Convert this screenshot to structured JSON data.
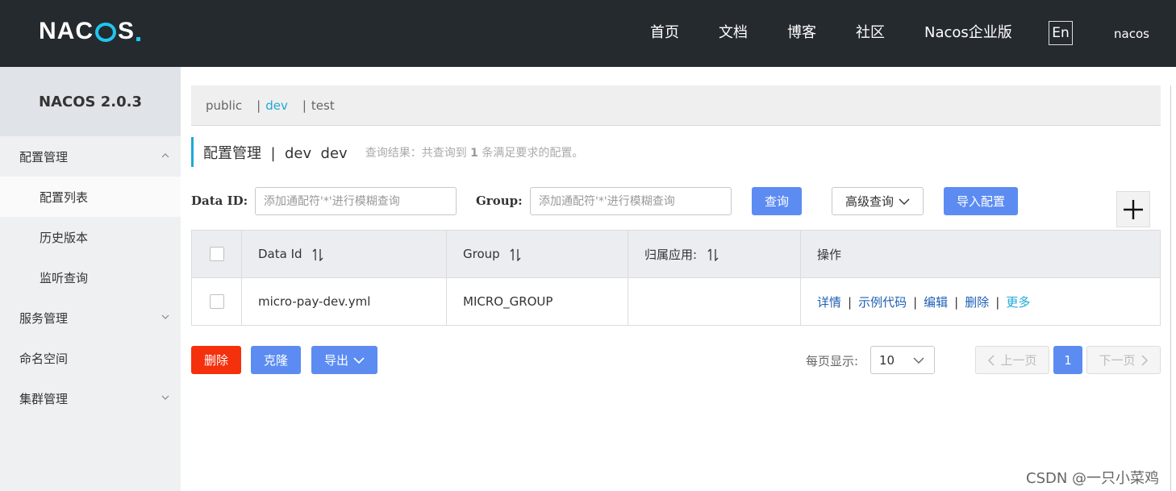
{
  "topbar": {
    "logo_text_left": "NA",
    "logo_text_mid": "C",
    "logo_text_right": "S",
    "nav": [
      "首页",
      "文档",
      "博客",
      "社区",
      "Nacos企业版"
    ],
    "lang": "En",
    "user": "nacos",
    "accent_color": "#1ec6f0"
  },
  "sidebar": {
    "title": "NACOS 2.0.3",
    "items": [
      {
        "label": "配置管理",
        "icon": "chevron-up-icon"
      },
      {
        "label": "配置列表"
      },
      {
        "label": "历史版本"
      },
      {
        "label": "监听查询"
      },
      {
        "label": "服务管理",
        "icon": "chevron-down-icon"
      },
      {
        "label": "命名空间"
      },
      {
        "label": "集群管理",
        "icon": "chevron-down-icon"
      }
    ]
  },
  "namespaces": {
    "items": [
      "public",
      "dev",
      "test"
    ],
    "separator": "|",
    "active": "dev"
  },
  "page": {
    "title": "配置管理  |  dev  dev",
    "hint_prefix": "查询结果：共查询到",
    "hint_count": "1",
    "hint_suffix": "条满足要求的配置。"
  },
  "filters": {
    "data_id_label": "Data ID:",
    "data_id_placeholder": "添加通配符'*'进行模糊查询",
    "group_label": "Group:",
    "group_placeholder": "添加通配符'*'进行模糊查询",
    "search_button": "查询",
    "advanced_button": "高级查询",
    "import_button": "导入配置"
  },
  "table": {
    "headers": [
      "Data Id",
      "Group",
      "归属应用:",
      "操作"
    ],
    "rows": [
      {
        "data_id": "micro-pay-dev.yml",
        "group": "MICRO_GROUP",
        "app": "",
        "actions": [
          "详情",
          "示例代码",
          "编辑",
          "删除",
          "更多"
        ]
      }
    ]
  },
  "bottom": {
    "delete_button": "删除",
    "clone_button": "克隆",
    "export_button": "导出",
    "per_page_label": "每页显示:",
    "per_page_value": "10",
    "prev_label": "上一页",
    "current_page": "1",
    "next_label": "下一页"
  },
  "watermark": "CSDN @一只小菜鸡"
}
